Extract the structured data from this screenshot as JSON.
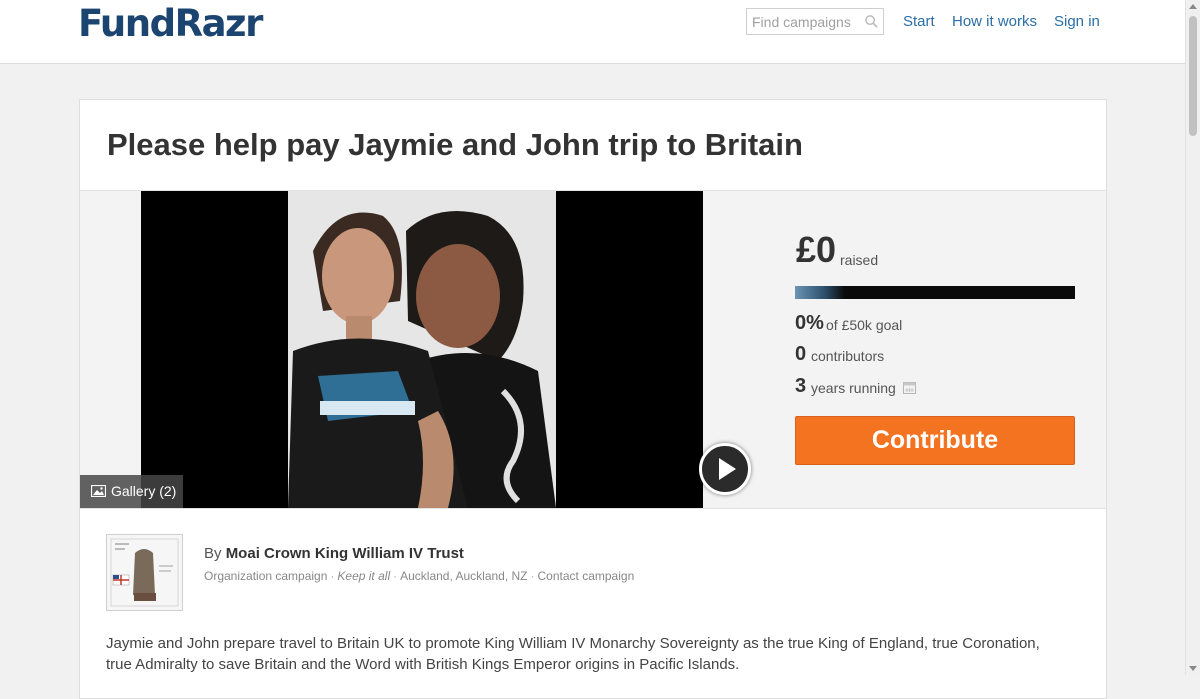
{
  "header": {
    "logo": "FundRazr",
    "search_placeholder": "Find campaigns",
    "nav": {
      "start": "Start",
      "how_it_works": "How it works",
      "sign_in": "Sign in"
    }
  },
  "campaign": {
    "title": "Please help pay Jaymie and John trip to Britain",
    "gallery_label": "Gallery (2)",
    "stats": {
      "raised_amount": "£0",
      "raised_label": "raised",
      "progress_fraction": 0,
      "percent": "0%",
      "goal_label": "of £50k goal",
      "contributors_count": "0",
      "contributors_label": "contributors",
      "running_count": "3",
      "running_label": "years running"
    },
    "contribute_label": "Contribute",
    "owner": {
      "by": "By",
      "name": "Moai Crown King William IV Trust",
      "type": "Organization campaign",
      "model": "Keep it all",
      "location": "Auckland, Auckland, NZ",
      "contact": "Contact campaign"
    },
    "description": "Jaymie and John prepare travel to Britain UK to promote King William IV Monarchy Sovereignty as the true King of England, true Coronation, true Admiralty to save Britain and the Word with British Kings Emperor origins in Pacific Islands."
  },
  "colors": {
    "brand": "#1b4470",
    "link": "#2a6fa7",
    "contribute": "#f47321"
  },
  "icons": [
    "search-icon",
    "play-icon",
    "image-icon",
    "calendar-icon"
  ]
}
